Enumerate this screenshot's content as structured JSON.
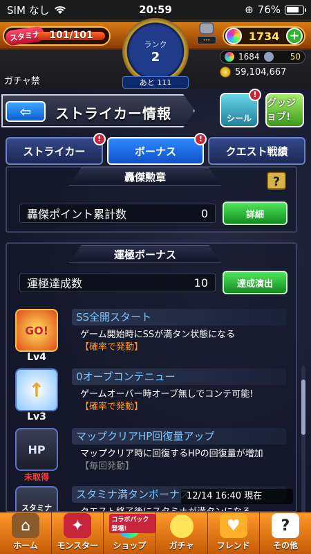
{
  "status_bar": {
    "carrier": "SIM なし",
    "time": "20:59",
    "battery": "76%"
  },
  "hud": {
    "stamina_label": "スタミナ",
    "stamina_value": "101/101",
    "rank_label": "ランク",
    "rank_value": "2",
    "rank_next": "あと 111",
    "robot_tag": "---",
    "orb_count": "1734",
    "sub_orbs": "1684",
    "sub_value": "50",
    "gold": "59,104,667",
    "gacha_ban": "ガチャ禁"
  },
  "header": {
    "title": "ストライカー情報",
    "seal_label": "シール",
    "goods_label": "グッジョブ!"
  },
  "tabs": [
    {
      "label": "ストライカー"
    },
    {
      "label": "ボーナス"
    },
    {
      "label": "クエスト戦績"
    }
  ],
  "sections": {
    "medal": {
      "title": "轟傑勲章",
      "help": "?",
      "row_label": "轟傑ポイント累計数",
      "row_value": "0",
      "button": "詳細"
    },
    "luck": {
      "title": "運極ボーナス",
      "row_label": "運極達成数",
      "row_value": "10",
      "button": "達成演出"
    }
  },
  "bonuses": [
    {
      "icon": "GO!",
      "level": "Lv4",
      "name": "SS全開スタート",
      "desc": "ゲーム開始時にSSが満タン状態になる",
      "note": "【確率で発動】"
    },
    {
      "icon": "↑",
      "level": "Lv3",
      "name": "0オーブコンテニュー",
      "desc": "ゲームオーバー時オーブ無しでコンテ可能!",
      "note": "【確率で発動】"
    },
    {
      "icon": "HP",
      "level": "未取得",
      "name": "マップクリアHP回復量アップ",
      "desc": "マップクリア時に回復するHPの回復量が増加",
      "note": "【毎回発動】"
    },
    {
      "icon": "スタミナ",
      "level": "",
      "name": "スタミナ満タンボーナス",
      "desc": "クエスト終了後にスタミナが満タンになる",
      "note": ""
    }
  ],
  "date_overlay": "12/14 16:40 現在",
  "nav": [
    {
      "label": "ホーム",
      "icon": "⌂"
    },
    {
      "label": "モンスター",
      "icon": "✦"
    },
    {
      "label": "ショップ",
      "icon": "●",
      "badge": "コラボパック登場!"
    },
    {
      "label": "ガチャ",
      "icon": "●"
    },
    {
      "label": "フレンド",
      "icon": "♥"
    },
    {
      "label": "その他",
      "icon": "?"
    }
  ],
  "colors": {
    "accent_orange": "#ff9a2a",
    "tab_active": "#2e8aff",
    "green_button": "#1fb52a",
    "note_orange": "#ff9a2a"
  }
}
